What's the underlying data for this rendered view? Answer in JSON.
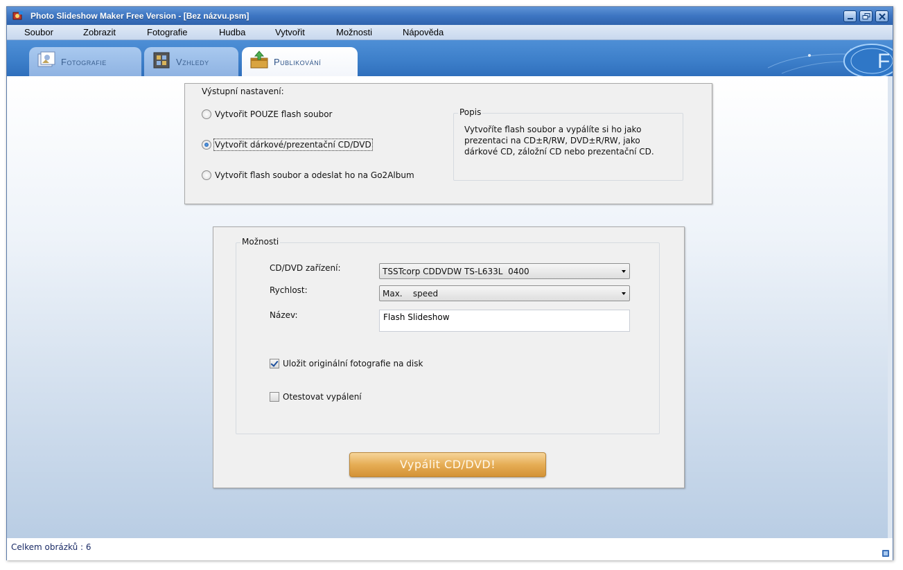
{
  "window": {
    "title": "Photo Slideshow Maker Free Version - [Bez názvu.psm]"
  },
  "menu": [
    "Soubor",
    "Zobrazit",
    "Fotografie",
    "Hudba",
    "Vytvořit",
    "Možnosti",
    "Nápověda"
  ],
  "tabs": [
    {
      "label": "Fotografie",
      "icon": "photos-icon",
      "active": false
    },
    {
      "label": "Vzhledy",
      "icon": "film-strip-icon",
      "active": false
    },
    {
      "label": "Publikování",
      "icon": "publish-box-icon",
      "active": true
    }
  ],
  "output": {
    "heading": "Výstupní nastavení:",
    "options": [
      {
        "label": "Vytvořit POUZE flash soubor",
        "selected": false
      },
      {
        "label": "Vytvořit dárkové/prezentační CD/DVD",
        "selected": true
      },
      {
        "label": "Vytvořit flash soubor a odeslat ho na Go2Album",
        "selected": false
      }
    ],
    "description": {
      "caption": "Popis",
      "text": "Vytvoříte flash soubor a vypálíte si ho jako prezentaci na CD±R/RW, DVD±R/RW, jako dárkové CD, záložní CD nebo prezentační CD."
    }
  },
  "options": {
    "caption": "Možnosti",
    "device_label": "CD/DVD zařízení:",
    "device_value": "TSSTcorp CDDVDW TS-L633L  0400",
    "speed_label": "Rychlost:",
    "speed_value": "Max.    speed",
    "name_label": "Název:",
    "name_value": "Flash Slideshow",
    "save_originals_label": "Uložit originální fotografie na disk",
    "save_originals_checked": true,
    "test_burn_label": "Otestovat vypálení",
    "test_burn_checked": false,
    "burn_button": "Vypálit CD/DVD!"
  },
  "status": {
    "text": "Celkem obrázků : 6"
  },
  "colors": {
    "titlebar": "#3d75c2",
    "tabbar": "#3c7ec9",
    "burn_button": "#e6ad55",
    "status_text": "#1a2b66"
  }
}
